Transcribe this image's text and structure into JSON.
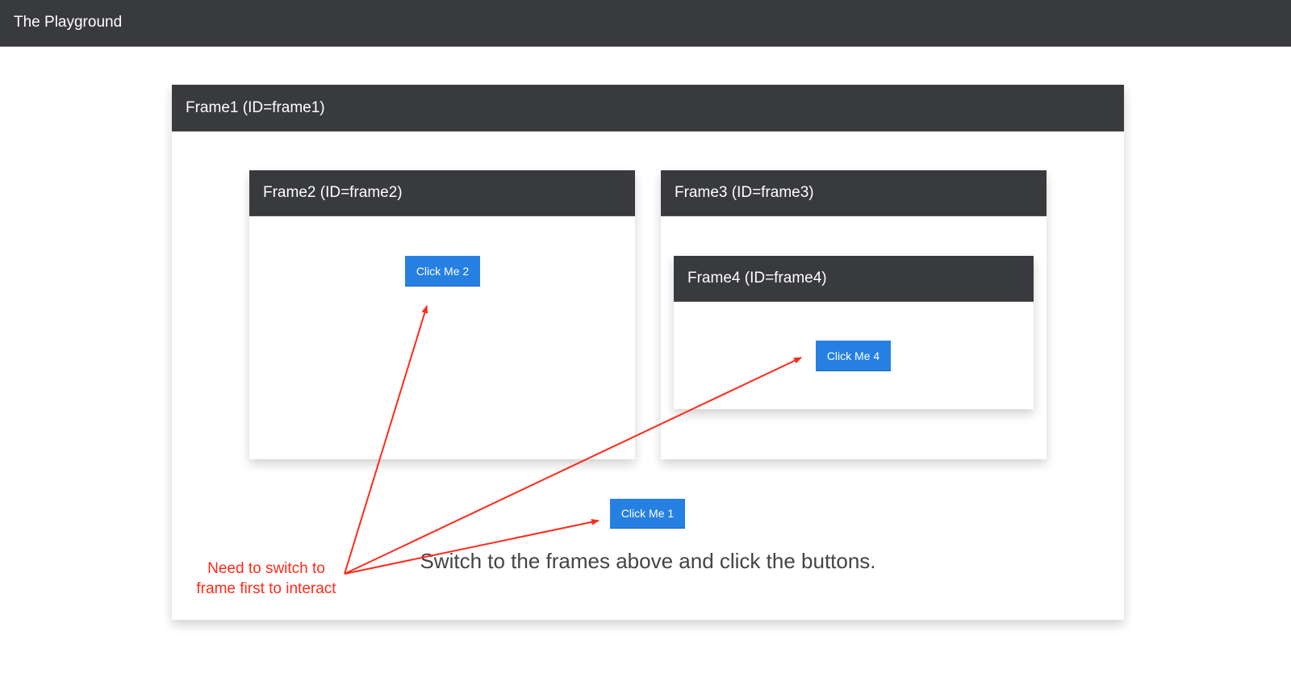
{
  "header": {
    "title": "The Playground"
  },
  "frame1": {
    "title": "Frame1 (ID=frame1)",
    "button": "Click Me 1",
    "caption": "Switch to the frames above and click the buttons."
  },
  "frame2": {
    "title": "Frame2 (ID=frame2)",
    "button": "Click Me 2"
  },
  "frame3": {
    "title": "Frame3 (ID=frame3)"
  },
  "frame4": {
    "title": "Frame4 (ID=frame4)",
    "button": "Click Me 4"
  },
  "annotation": {
    "line1": "Need to switch to",
    "line2": "frame first to interact",
    "color": "#ff2a1a"
  },
  "colors": {
    "header_bg": "#393a3d",
    "button": "#2680e2"
  }
}
